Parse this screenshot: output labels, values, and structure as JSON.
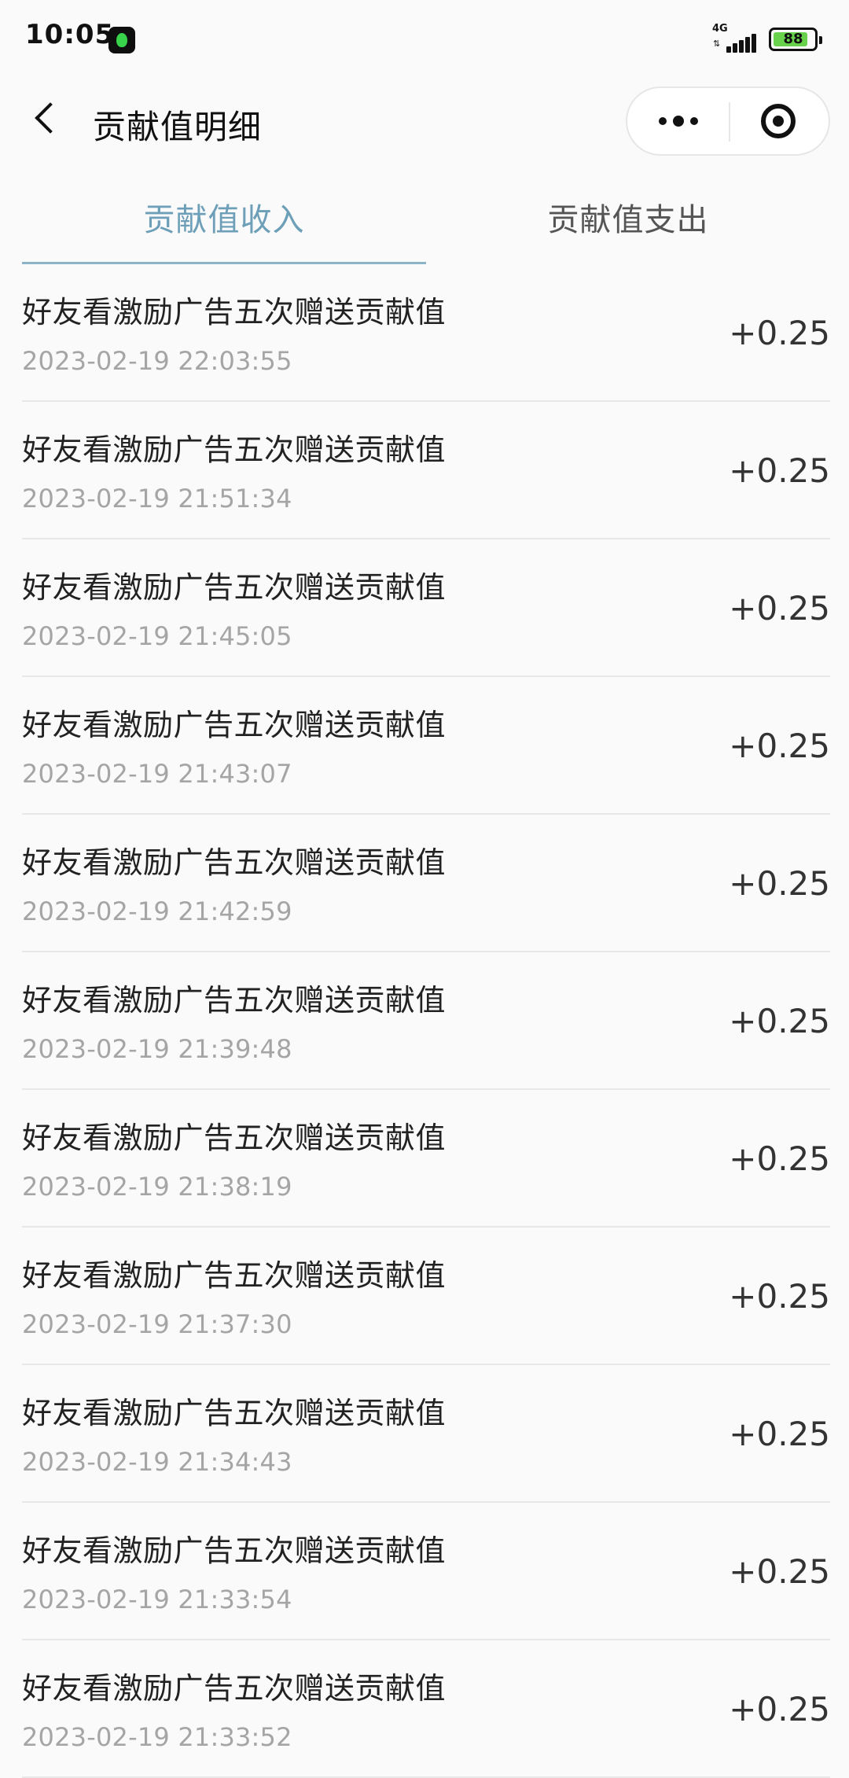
{
  "status_bar": {
    "time": "10:05",
    "network_type": "4G",
    "network_arrows": "⇅",
    "signal_level": 5,
    "battery_level": 88
  },
  "header": {
    "title": "贡献值明细"
  },
  "tabs": [
    {
      "label": "贡献值收入",
      "active": true
    },
    {
      "label": "贡献值支出",
      "active": false
    }
  ],
  "transactions": [
    {
      "title": "好友看激励广告五次赠送贡献值",
      "time": "2023-02-19 22:03:55",
      "amount": "+0.25"
    },
    {
      "title": "好友看激励广告五次赠送贡献值",
      "time": "2023-02-19 21:51:34",
      "amount": "+0.25"
    },
    {
      "title": "好友看激励广告五次赠送贡献值",
      "time": "2023-02-19 21:45:05",
      "amount": "+0.25"
    },
    {
      "title": "好友看激励广告五次赠送贡献值",
      "time": "2023-02-19 21:43:07",
      "amount": "+0.25"
    },
    {
      "title": "好友看激励广告五次赠送贡献值",
      "time": "2023-02-19 21:42:59",
      "amount": "+0.25"
    },
    {
      "title": "好友看激励广告五次赠送贡献值",
      "time": "2023-02-19 21:39:48",
      "amount": "+0.25"
    },
    {
      "title": "好友看激励广告五次赠送贡献值",
      "time": "2023-02-19 21:38:19",
      "amount": "+0.25"
    },
    {
      "title": "好友看激励广告五次赠送贡献值",
      "time": "2023-02-19 21:37:30",
      "amount": "+0.25"
    },
    {
      "title": "好友看激励广告五次赠送贡献值",
      "time": "2023-02-19 21:34:43",
      "amount": "+0.25"
    },
    {
      "title": "好友看激励广告五次赠送贡献值",
      "time": "2023-02-19 21:33:54",
      "amount": "+0.25"
    },
    {
      "title": "好友看激励广告五次赠送贡献值",
      "time": "2023-02-19 21:33:52",
      "amount": "+0.25"
    }
  ],
  "colors": {
    "active_tab": "#6d9fb8",
    "inactive_tab": "#555555",
    "time_text": "#a5a5a5",
    "divider": "#e8e8e8",
    "battery_fill": "#69d24d"
  },
  "icons": {
    "back": "back-icon",
    "more": "more-icon",
    "close": "close-icon",
    "app": "app-icon",
    "signal": "signal-icon",
    "battery": "battery-icon"
  }
}
